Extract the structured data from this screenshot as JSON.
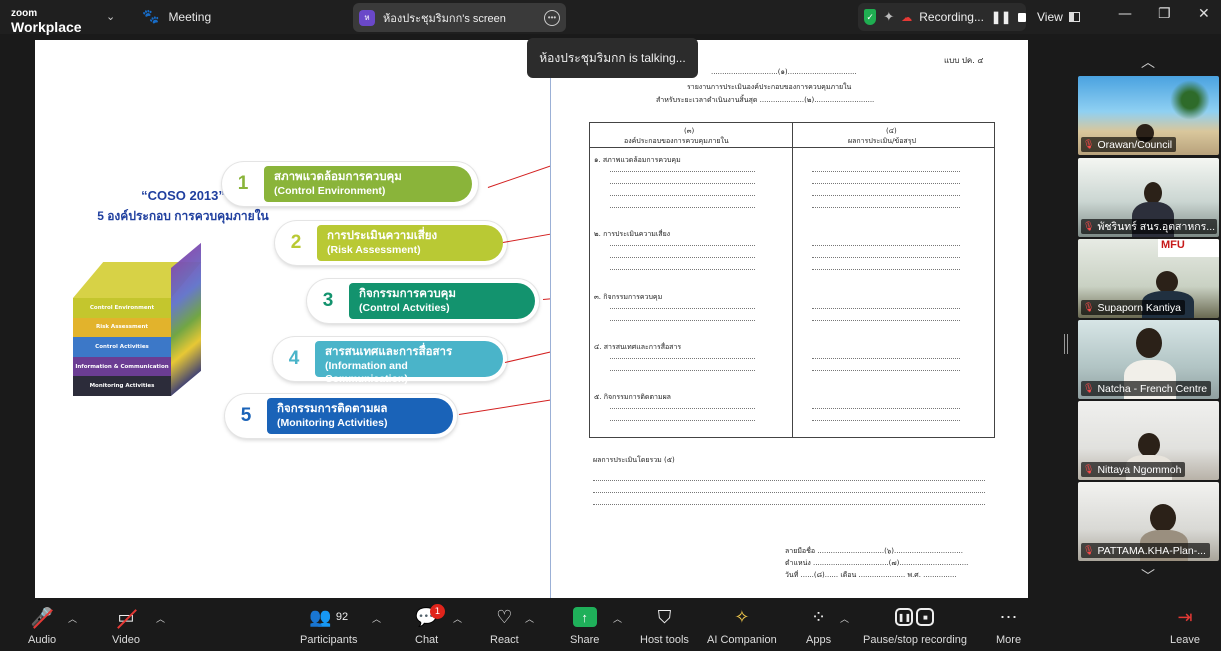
{
  "titlebar": {
    "logo_top": "zoom",
    "logo_bottom": "Workplace",
    "meeting_label": "Meeting",
    "screen_share_label": "ห้องประชุมริมกก's screen",
    "screen_share_avatar": "ห",
    "recording_label": "Recording...",
    "view_label": "View"
  },
  "talking_tooltip": "ห้องประชุมริมกก is talking...",
  "slide": {
    "title_en": "“COSO 2013”",
    "title_th": "5 องค์ประกอบ การควบคุมภายใน",
    "cube_bands": [
      "Control Environment",
      "Risk Assessment",
      "Control Activities",
      "Information & Communication",
      "Monitoring Activities"
    ],
    "components": [
      {
        "num": "1",
        "th": "สภาพแวดล้อมการควบคุม",
        "en": "(Control Environment)",
        "color": "#8ab43a"
      },
      {
        "num": "2",
        "th": "การประเมินความเสี่ยง",
        "en": "(Risk Assessment)",
        "color": "#b9c934"
      },
      {
        "num": "3",
        "th": "กิจกรรมการควบคุม",
        "en": "(Control Actvities)",
        "color": "#13936e"
      },
      {
        "num": "4",
        "th": "สารสนเทศและการสื่อสาร",
        "en": "(Information and Communication)",
        "color": "#4ab4c9"
      },
      {
        "num": "5",
        "th": "กิจกรรมการติดตามผล",
        "en": "(Monitoring Activities)",
        "color": "#1a63b8"
      }
    ]
  },
  "form": {
    "form_code": "แบบ ปค. ๔",
    "line1": "..............................(๑)...............................",
    "line2": "รายงานการประเมินองค์ประกอบของการควบคุมภายใน",
    "line3": "สำหรับระยะเวลาดำเนินงานสิ้นสุด ....................(๒)...........................",
    "col1_num": "(๓)",
    "col1_head": "องค์ประกอบของการควบคุมภายใน",
    "col2_num": "(๔)",
    "col2_head": "ผลการประเมิน/ข้อสรุป",
    "items": [
      "๑. สภาพแวดล้อมการควบคุม",
      "๒. การประเมินความเสี่ยง",
      "๓. กิจกรรมการควบคุม",
      "๔. สารสนเทศและการสื่อสาร",
      "๕. กิจกรรมการติดตามผล"
    ],
    "overall": "ผลการประเมินโดยรวม (๕)",
    "sign": "ลายมือชื่อ ..............................(๖)...............................",
    "position": "ตำแหน่ง ..................................(๗)...............................",
    "date": "วันที่ ......(๘)...... เดือน ..................... พ.ศ. ..............."
  },
  "participants": [
    {
      "name": "Orawan/Council"
    },
    {
      "name": "พัชรินทร์ สนร.อุตสาหกร..."
    },
    {
      "name": "Supaporn Kantiya"
    },
    {
      "name": "Natcha - French Centre"
    },
    {
      "name": "Nittaya Ngommoh"
    },
    {
      "name": "PATTAMA.KHA-Plan-..."
    }
  ],
  "toolbar": {
    "audio": "Audio",
    "video": "Video",
    "participants": "Participants",
    "participants_count": "92",
    "chat": "Chat",
    "chat_badge": "1",
    "react": "React",
    "share": "Share",
    "host_tools": "Host tools",
    "ai_companion": "AI Companion",
    "apps": "Apps",
    "pause_recording": "Pause/stop recording",
    "more": "More",
    "leave": "Leave"
  }
}
